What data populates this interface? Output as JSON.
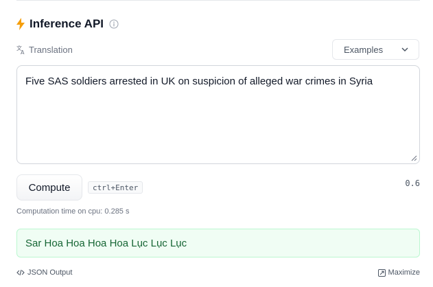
{
  "header": {
    "title": "Inference API",
    "icon": "lightning-icon",
    "accent": "#f59e0b"
  },
  "task": {
    "label": "Translation",
    "icon": "translate-icon"
  },
  "examples": {
    "label": "Examples"
  },
  "input": {
    "text": "Five SAS soldiers arrested in UK on suspicion of alleged war crimes in Syria"
  },
  "compute": {
    "label": "Compute",
    "shortcut": "ctrl+Enter",
    "threshold": "0.6"
  },
  "timing": {
    "text": "Computation time on cpu: 0.285 s"
  },
  "output": {
    "text": "Sar Hoa Hoa Hoa Hoa Lục Lục Lục"
  },
  "footer": {
    "json_label": "JSON Output",
    "maximize_label": "Maximize"
  }
}
